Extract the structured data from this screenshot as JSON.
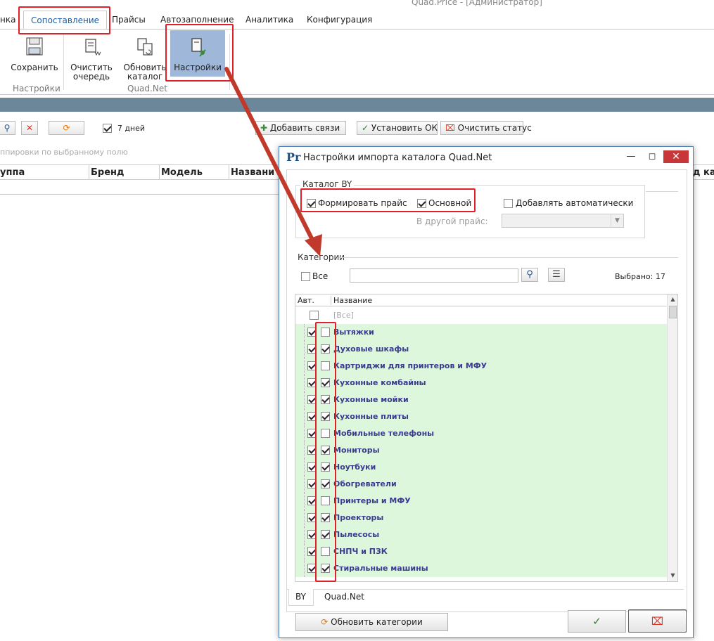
{
  "window_title": "Quad.Price - [Администратор]",
  "ribbon": {
    "tabs": [
      "нка",
      "Сопоставление",
      "Прайсы",
      "Автозаполнение",
      "Аналитика",
      "Конфигурация"
    ],
    "buttons": {
      "save": "Сохранить",
      "clear_queue_1": "Очистить",
      "clear_queue_2": "очередь",
      "update_catalog_1": "Обновить",
      "update_catalog_2": "каталог",
      "settings": "Настройки"
    },
    "groups": {
      "settings": "Настройки",
      "quadnet": "Quad.Net"
    }
  },
  "toolbar": {
    "days_label": "7 дней",
    "days_checked": true,
    "add_links": "Добавить связи",
    "set_ok": "Установить ОК",
    "clear_status": "Очистить статус"
  },
  "grid": {
    "group_hint": "ппировки по выбранному полю",
    "columns": [
      "уппа",
      "Бренд",
      "Модель",
      "Названи",
      "д ка"
    ]
  },
  "dialog": {
    "title": "Настройки импорта каталога Quad.Net",
    "catalog_group": "Каталог BY",
    "form_price": "Формировать прайс",
    "form_price_checked": true,
    "main": "Основной",
    "main_checked": true,
    "add_auto": "Добавлять автоматически",
    "add_auto_checked": false,
    "other_price_label": "В другой прайс:",
    "categories_group": "Категории",
    "all_label": "Все",
    "search_value": "",
    "selected_label": "Выбрано: 17",
    "table": {
      "col_auto": "Авт.",
      "col_name": "Название",
      "all_row": "[Все]",
      "rows": [
        {
          "name": "Вытяжки",
          "auto": true,
          "sel": false
        },
        {
          "name": "Духовые шкафы",
          "auto": true,
          "sel": true
        },
        {
          "name": "Картриджи для принтеров и МФУ",
          "auto": true,
          "sel": false
        },
        {
          "name": "Кухонные комбайны",
          "auto": true,
          "sel": true
        },
        {
          "name": "Кухонные мойки",
          "auto": true,
          "sel": true
        },
        {
          "name": "Кухонные плиты",
          "auto": true,
          "sel": true
        },
        {
          "name": "Мобильные телефоны",
          "auto": true,
          "sel": false
        },
        {
          "name": "Мониторы",
          "auto": true,
          "sel": true
        },
        {
          "name": "Ноутбуки",
          "auto": true,
          "sel": true
        },
        {
          "name": "Обогреватели",
          "auto": true,
          "sel": true
        },
        {
          "name": "Принтеры и МФУ",
          "auto": true,
          "sel": false
        },
        {
          "name": "Проекторы",
          "auto": true,
          "sel": true
        },
        {
          "name": "Пылесосы",
          "auto": true,
          "sel": true
        },
        {
          "name": "СНПЧ и ПЗК",
          "auto": true,
          "sel": false
        },
        {
          "name": "Стиральные машины",
          "auto": true,
          "sel": true
        }
      ]
    },
    "bottom_tabs": [
      "BY",
      "Quad.Net"
    ],
    "update_categories": "Обновить категории",
    "ok_icon": "check-icon",
    "cancel_icon": "cancel-icon"
  },
  "colors": {
    "highlight": "#e0202a",
    "arrow": "#c0392b",
    "row_bg": "#ddf7dd",
    "category_text": "#3b3b8f"
  }
}
